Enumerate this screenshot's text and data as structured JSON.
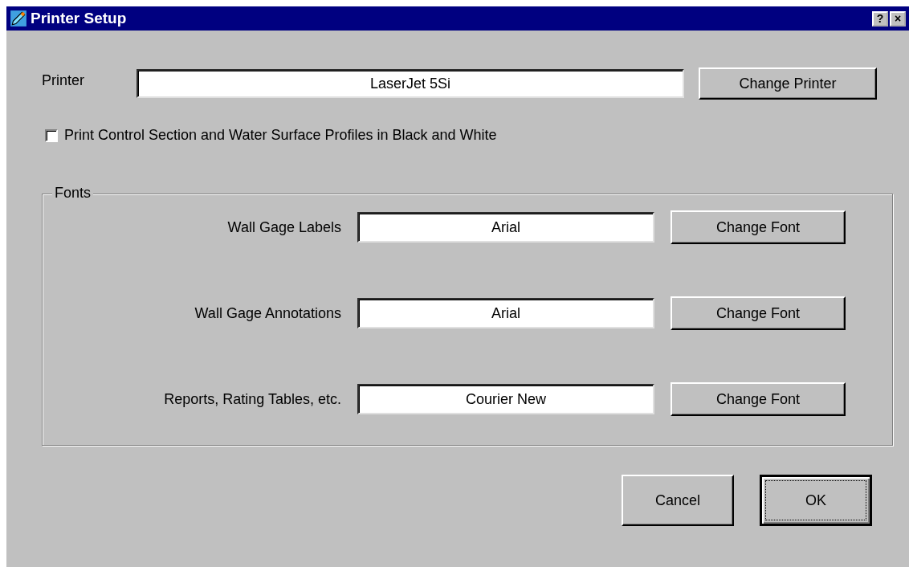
{
  "window": {
    "title": "Printer Setup",
    "controls": [
      "?",
      "×"
    ]
  },
  "printer": {
    "label": "Printer",
    "value": "LaserJet 5Si",
    "button": "Change Printer"
  },
  "checkbox": {
    "label": "Print Control Section and Water Surface Profiles in Black and White",
    "checked": false
  },
  "fonts": {
    "title": "Fonts",
    "rows": [
      {
        "label": "Wall Gage Labels",
        "value": "Arial",
        "button": "Change Font"
      },
      {
        "label": "Wall Gage Annotations",
        "value": "Arial",
        "button": "Change Font"
      },
      {
        "label": "Reports, Rating Tables, etc.",
        "value": "Courier New",
        "button": "Change Font"
      }
    ]
  },
  "buttons": [
    {
      "label": "Cancel",
      "default": false
    },
    {
      "label": "OK",
      "default": true
    }
  ]
}
